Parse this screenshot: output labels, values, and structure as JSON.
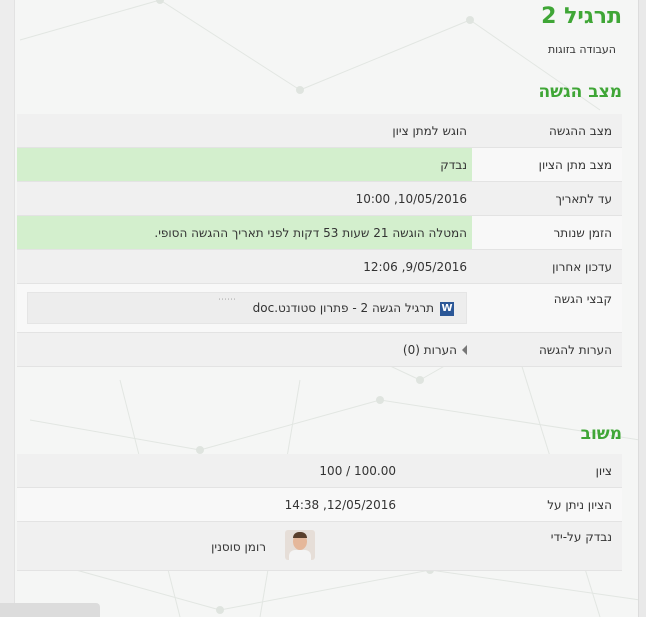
{
  "assignment": {
    "title": "תרגיל 2",
    "subtitle": "העבודה בזוגות"
  },
  "submission": {
    "heading": "מצב הגשה",
    "rows": [
      {
        "label": "מצב ההגשה",
        "value": "הוגש למתן ציון"
      },
      {
        "label": "מצב מתן הציון",
        "value": "נבדק"
      },
      {
        "label": "עד לתאריך",
        "value": "10/05/2016, 10:00"
      },
      {
        "label": "הזמן שנותר",
        "value": "המטלה הוגשה 21 שעות 53 דקות לפני תאריך ההגשה הסופי."
      },
      {
        "label": "עדכון אחרון",
        "value": "9/05/2016, 12:06"
      },
      {
        "label": "קבצי הגשה",
        "value": "תרגיל הגשה 2 - פתרון סטודנט.doc"
      },
      {
        "label": "הערות להגשה",
        "value": "הערות (0)"
      }
    ],
    "file_icon": "word-document-icon",
    "file_icon_letter": "W"
  },
  "feedback": {
    "heading": "משוב",
    "rows": [
      {
        "label": "ציון",
        "value": "100.00 / 100"
      },
      {
        "label": "הציון ניתן על",
        "value": "12/05/2016, 14:38"
      },
      {
        "label": "נבדק על-ידי",
        "value": "רומן סוסנין"
      }
    ]
  },
  "colors": {
    "accent": "#3fa636",
    "highlight": "#d3efcd"
  }
}
